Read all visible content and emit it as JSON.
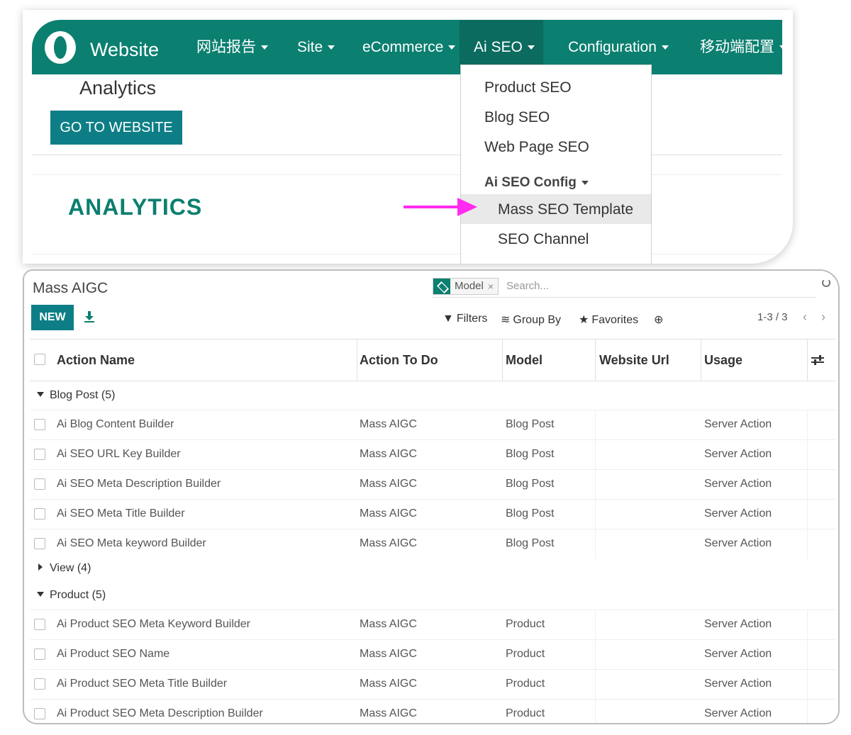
{
  "navbar": {
    "brand": "Website",
    "items": [
      {
        "label": "网站报告"
      },
      {
        "label": "Site"
      },
      {
        "label": "eCommerce"
      },
      {
        "label": "Ai SEO"
      },
      {
        "label": "Configuration"
      },
      {
        "label": "移动端配置"
      }
    ],
    "active_item": "Ai SEO"
  },
  "website_page": {
    "header_title": "Analytics",
    "go_button": "GO TO WEBSITE",
    "section_title": "ANALYTICS"
  },
  "dropdown": {
    "items": [
      "Product SEO",
      "Blog SEO",
      "Web Page SEO"
    ],
    "section": "Ai SEO Config",
    "sub_items": [
      "Mass SEO Template",
      "SEO Channel"
    ],
    "highlighted": "Mass SEO Template",
    "arrow_color": "#ff2bf0"
  },
  "list_view": {
    "title": "Mass AIGC",
    "search": {
      "facet_label": "Model",
      "facet_icon": "layers-icon",
      "placeholder": "Search..."
    },
    "new_button": "NEW",
    "toolbar": {
      "filters": "Filters",
      "group_by": "Group By",
      "favorites": "Favorites"
    },
    "pager": "1-3 / 3",
    "columns": [
      "Action Name",
      "Action To Do",
      "Model",
      "Website Url",
      "Usage"
    ],
    "groups": [
      {
        "label": "Blog Post (5)",
        "expanded": true,
        "rows": [
          [
            "Ai Blog Content Builder",
            "Mass AIGC",
            "Blog Post",
            "",
            "Server Action"
          ],
          [
            "Ai SEO URL Key Builder",
            "Mass AIGC",
            "Blog Post",
            "",
            "Server Action"
          ],
          [
            "Ai SEO Meta Description Builder",
            "Mass AIGC",
            "Blog Post",
            "",
            "Server Action"
          ],
          [
            "Ai SEO Meta Title Builder",
            "Mass AIGC",
            "Blog Post",
            "",
            "Server Action"
          ],
          [
            "Ai SEO Meta keyword Builder",
            "Mass AIGC",
            "Blog Post",
            "",
            "Server Action"
          ]
        ]
      },
      {
        "label": "View (4)",
        "expanded": false,
        "rows": []
      },
      {
        "label": "Product (5)",
        "expanded": true,
        "rows": [
          [
            "Ai Product SEO Meta Keyword Builder",
            "Mass AIGC",
            "Product",
            "",
            "Server Action"
          ],
          [
            "Ai Product SEO Name",
            "Mass AIGC",
            "Product",
            "",
            "Server Action"
          ],
          [
            "Ai Product SEO Meta Title Builder",
            "Mass AIGC",
            "Product",
            "",
            "Server Action"
          ],
          [
            "Ai Product SEO Meta Description Builder",
            "Mass AIGC",
            "Product",
            "",
            "Server Action"
          ]
        ]
      }
    ]
  },
  "colors": {
    "primary": "#0b7f70",
    "button": "#0e7e86",
    "highlight": "#e9e9e9"
  }
}
